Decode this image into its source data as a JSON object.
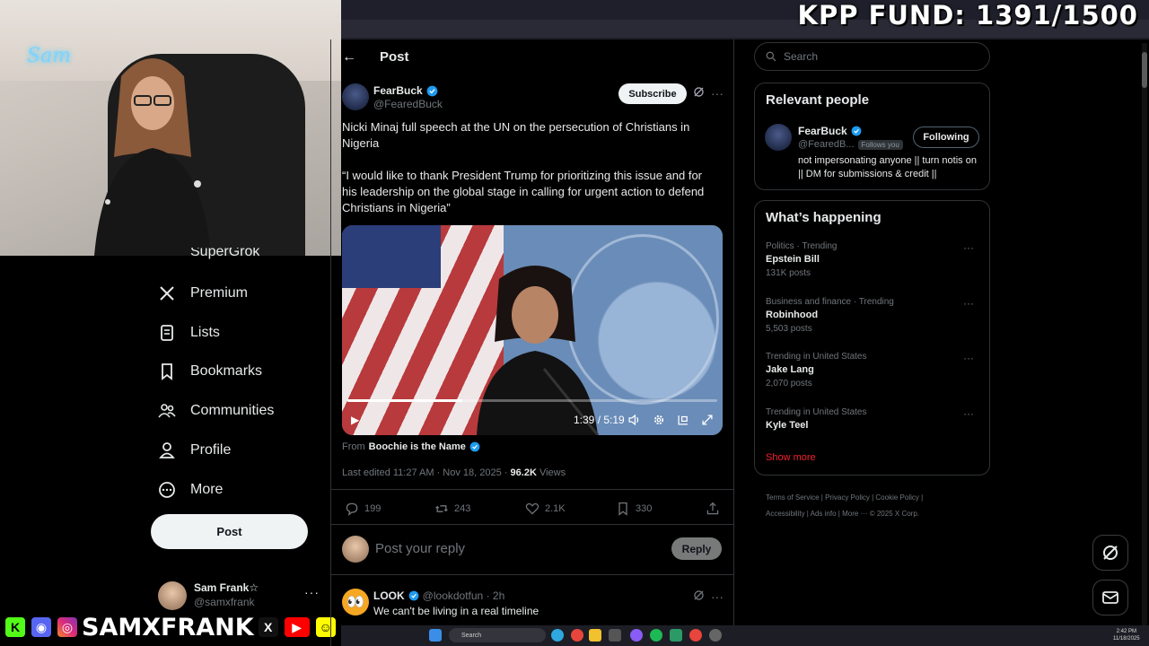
{
  "overlay": {
    "fund_label": "KPP FUND: 1391/1500",
    "neon_sign": "Sam",
    "brand_name": "SAMXFRANK",
    "social_icons": [
      "kick-icon",
      "discord-icon",
      "instagram-icon",
      "x-icon",
      "youtube-icon",
      "snapchat-icon"
    ]
  },
  "sidebar": {
    "partial_item": "SuperGrok",
    "items": [
      {
        "label": "Premium",
        "icon": "x-logo-icon"
      },
      {
        "label": "Lists",
        "icon": "list-icon"
      },
      {
        "label": "Bookmarks",
        "icon": "bookmark-icon"
      },
      {
        "label": "Communities",
        "icon": "communities-icon"
      },
      {
        "label": "Profile",
        "icon": "profile-icon"
      },
      {
        "label": "More",
        "icon": "more-circle-icon"
      }
    ],
    "post_button": "Post",
    "account": {
      "name": "Sam Frank☆",
      "handle": "@samxfrank",
      "more": "···"
    }
  },
  "header": {
    "back": "←",
    "title": "Post"
  },
  "post": {
    "author_name": "FearBuck",
    "author_handle": "@FearedBuck",
    "subscribe_label": "Subscribe",
    "more": "···",
    "text_line1": "Nicki Minaj full speech at the UN on the persecution of Christians in Nigeria",
    "text_line2": "“I would like to thank President Trump for prioritizing this issue and for his leadership on the global stage in calling for urgent action to defend Christians in Nigeria”",
    "video": {
      "time": "1:39 / 5:19",
      "progress": 0.31
    },
    "from_prefix": "From",
    "from_name": "Boochie is the Name",
    "meta_prefix": "Last edited 11:27 AM · Nov 18, 2025 · ",
    "views_count": "96.2K",
    "views_label": " Views",
    "actions": {
      "replies": "199",
      "reposts": "243",
      "likes": "2.1K",
      "bookmarks": "330"
    }
  },
  "reply_box": {
    "placeholder": "Post your reply",
    "button": "Reply"
  },
  "reply": {
    "name": "LOOK",
    "handle_time": "@lookdotfun · 2h",
    "text": "We can't be living in a real timeline",
    "more": "···"
  },
  "right": {
    "search_placeholder": "Search",
    "relevant": {
      "title": "Relevant people",
      "name": "FearBuck",
      "handle": "@FearedB...",
      "follows_you": "Follows you",
      "button": "Following",
      "bio": "not impersonating anyone || turn notis on || DM for submissions & credit ||"
    },
    "happening": {
      "title": "What’s happening",
      "trends": [
        {
          "category": "Politics · Trending",
          "title": "Epstein Bill",
          "count": "131K posts"
        },
        {
          "category": "Business and finance · Trending",
          "title": "Robinhood",
          "count": "5,503 posts"
        },
        {
          "category": "Trending in United States",
          "title": "Jake Lang",
          "count": "2,070 posts"
        },
        {
          "category": "Trending in United States",
          "title": "Kyle Teel",
          "count": ""
        }
      ],
      "show_more": "Show more",
      "more": "···"
    },
    "footer_line1": "Terms of Service  |  Privacy Policy  |  Cookie Policy  |",
    "footer_line2": "Accessibility  |  Ads info  |  More ···  © 2025 X Corp."
  },
  "taskbar": {
    "search": "Search",
    "time": "2:42 PM",
    "date": "11/18/2025"
  },
  "colors": {
    "verified": "#1d9bf0",
    "show_more": "#f4212e",
    "background": "#000000"
  }
}
